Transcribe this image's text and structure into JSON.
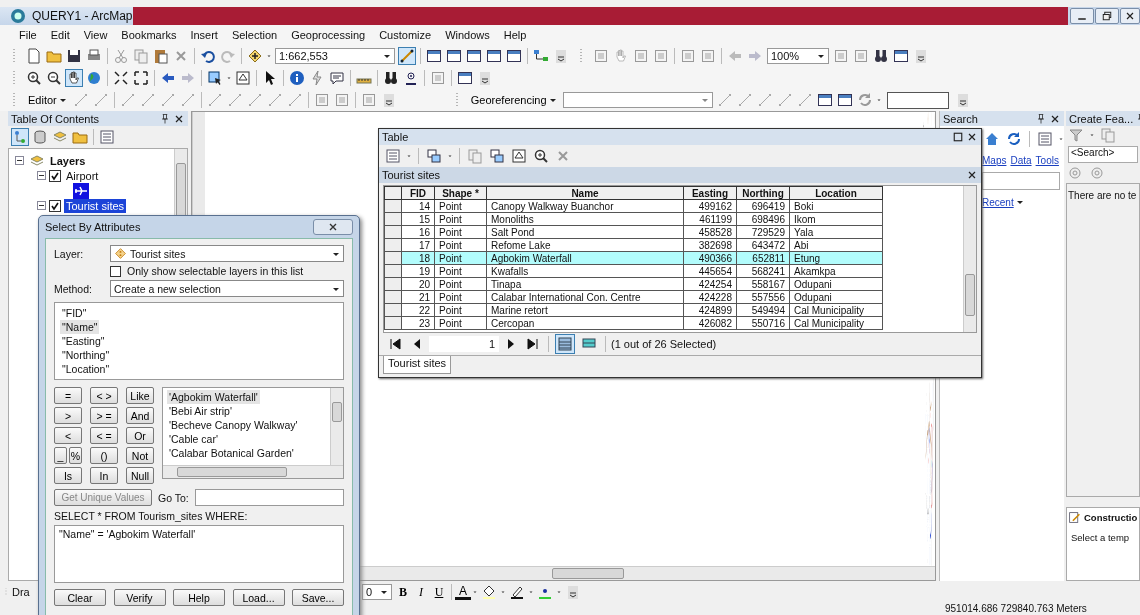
{
  "window": {
    "title": "QUERY1 - ArcMap"
  },
  "menu": [
    "File",
    "Edit",
    "View",
    "Bookmarks",
    "Insert",
    "Selection",
    "Geoprocessing",
    "Customize",
    "Windows",
    "Help"
  ],
  "toolbar": {
    "scale": "1:662,553",
    "zoom": "100%",
    "editor": "Editor",
    "georeferencing": "Georeferencing",
    "pan_selected": true,
    "editor_toolbar_selected": true
  },
  "toc": {
    "title": "Table Of Contents",
    "views": [
      {
        "selected": true
      },
      {
        "selected": false
      },
      {
        "selected": false
      },
      {
        "selected": false
      },
      {
        "selected": false
      }
    ],
    "tree": [
      {
        "label": "Layers",
        "expanded": true,
        "children": [
          {
            "label": "Airport",
            "checked": true,
            "expanded": true,
            "selected": false
          },
          {
            "label": "Tourist sites",
            "checked": true,
            "expanded": true,
            "selected": true
          }
        ]
      }
    ]
  },
  "search_panel": {
    "title": "Search",
    "links": [
      "Maps",
      "Data",
      "Tools"
    ],
    "recent": "Recent"
  },
  "create_features": {
    "title": "Create Fea...",
    "search": "<Search>",
    "message": "There are no te",
    "construction": "Constructio",
    "construction_message": "Select a temp"
  },
  "table_window": {
    "title": "Table",
    "layer_title": "Tourist sites",
    "columns": [
      {
        "label": "FID",
        "kind": "number"
      },
      {
        "label": "Shape *",
        "kind": "text"
      },
      {
        "label": "Name",
        "kind": "text"
      },
      {
        "label": "Easting",
        "kind": "number"
      },
      {
        "label": "Northing",
        "kind": "number"
      },
      {
        "label": "Location",
        "kind": "text"
      }
    ],
    "rows": [
      {
        "cells": [
          "14",
          "Point",
          "Canopy Walkway Buanchor",
          "499162",
          "696419",
          "Boki"
        ],
        "selected": false
      },
      {
        "cells": [
          "15",
          "Point",
          "Monoliths",
          "461199",
          "698496",
          "Ikom"
        ],
        "selected": false
      },
      {
        "cells": [
          "16",
          "Point",
          "Salt Pond",
          "458528",
          "729529",
          "Yala"
        ],
        "selected": false
      },
      {
        "cells": [
          "17",
          "Point",
          "Refome Lake",
          "382698",
          "643472",
          "Abi"
        ],
        "selected": false
      },
      {
        "cells": [
          "18",
          "Point",
          "Agbokim Waterfall",
          "490366",
          "652811",
          "Etung"
        ],
        "selected": true
      },
      {
        "cells": [
          "19",
          "Point",
          "Kwafalls",
          "445654",
          "568241",
          "Akamkpa"
        ],
        "selected": false
      },
      {
        "cells": [
          "20",
          "Point",
          "Tinapa",
          "424254",
          "558167",
          "Odupani"
        ],
        "selected": false
      },
      {
        "cells": [
          "21",
          "Point",
          "Calabar International Con. Centre",
          "424228",
          "557556",
          "Odupani"
        ],
        "selected": false
      },
      {
        "cells": [
          "22",
          "Point",
          "Marine retort",
          "424899",
          "549494",
          "Cal Municipality"
        ],
        "selected": false
      },
      {
        "cells": [
          "23",
          "Point",
          "Cercopan",
          "426082",
          "550716",
          "Cal Municipality"
        ],
        "selected": false
      }
    ],
    "page": "1",
    "views": [
      {
        "kind": "all",
        "selected": true
      },
      {
        "kind": "selected",
        "selected": false
      }
    ],
    "selection_info": "(1 out of 26 Selected)",
    "tabs": [
      {
        "label": "Tourist sites",
        "selected": true
      }
    ]
  },
  "select_dialog": {
    "title": "Select By Attributes",
    "layer_label": "Layer:",
    "layer": "Tourist sites",
    "selectable_only": {
      "label": "Only show selectable layers in this list",
      "checked": false
    },
    "method_label": "Method:",
    "method": "Create a new selection",
    "fields": [
      {
        "label": "\"FID\"",
        "selected": false
      },
      {
        "label": "\"Name\"",
        "selected": true
      },
      {
        "label": "\"Easting\"",
        "selected": false
      },
      {
        "label": "\"Northing\"",
        "selected": false
      },
      {
        "label": "\"Location\"",
        "selected": false
      }
    ],
    "operators": [
      "=",
      "< >",
      "Like",
      ">",
      "> =",
      "And",
      "<",
      "< =",
      "Or",
      "_",
      "%",
      "()",
      "Not",
      "Is",
      "In",
      "Null"
    ],
    "values": [
      {
        "label": "'Agbokim Waterfall'",
        "selected": true
      },
      {
        "label": "'Bebi Air strip'",
        "selected": false
      },
      {
        "label": "'Becheve Canopy Walkway'",
        "selected": false
      },
      {
        "label": "'Cable car'",
        "selected": false
      },
      {
        "label": "'Calabar Botanical Garden'",
        "selected": false
      }
    ],
    "unique_button": {
      "label": "Get Unique Values",
      "disabled": true
    },
    "goto_label": "Go To:",
    "query_label": "SELECT * FROM Tourism_sites WHERE:",
    "expression": "\"Name\" = 'Agbokim Waterfall'",
    "buttons": [
      "Clear",
      "Verify",
      "Help",
      "Load...",
      "Save..."
    ]
  },
  "drawing_toolbar": {
    "label": "Dra",
    "font_size": "0",
    "bold": "B",
    "italic": "I",
    "underline": "U",
    "font_color": "A"
  },
  "status_bar": "951014.686  729840.763 Meters"
}
